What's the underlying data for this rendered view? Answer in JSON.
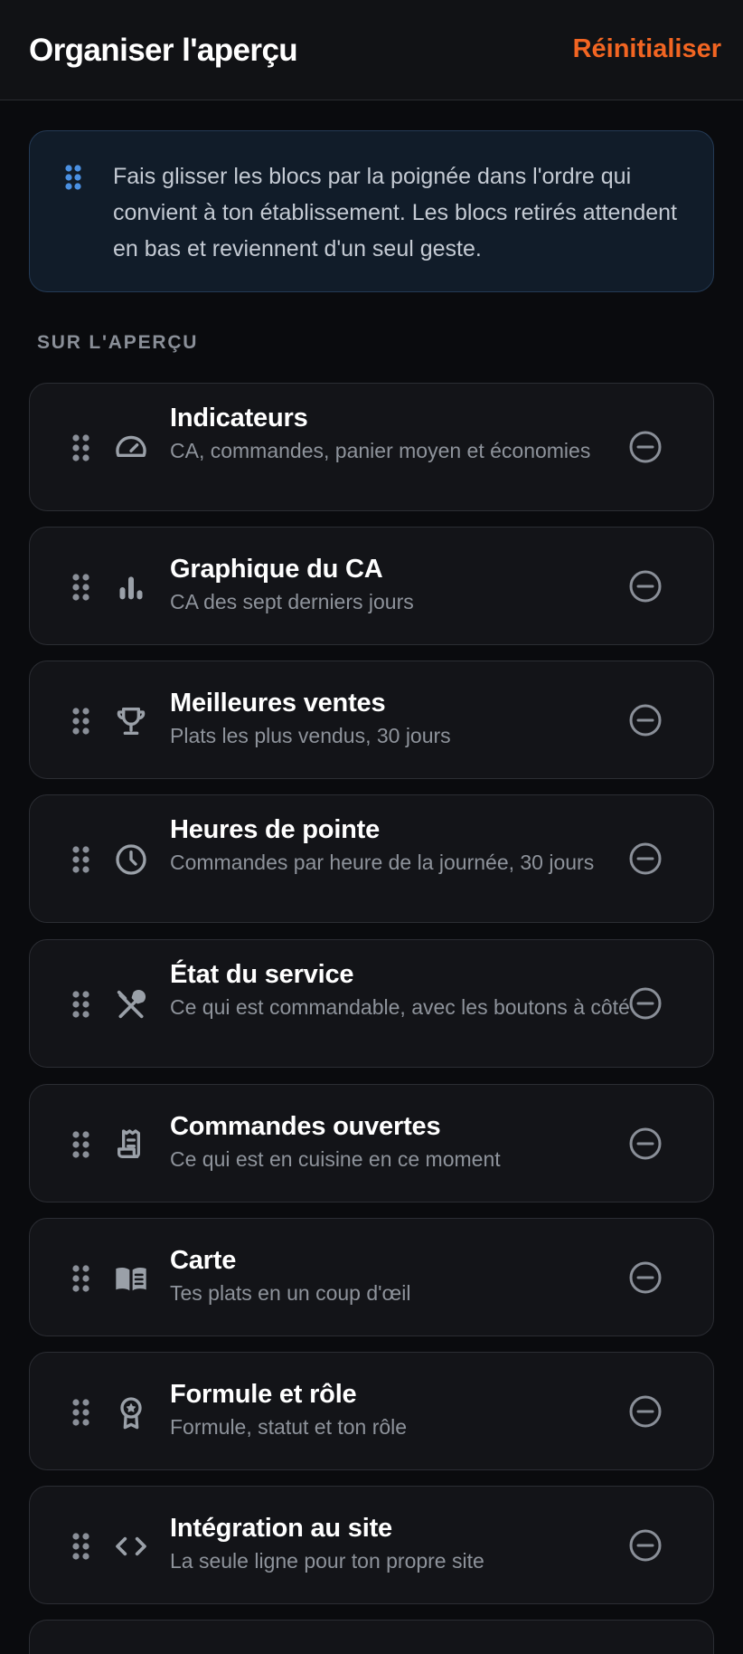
{
  "header": {
    "title": "Organiser l'aperçu",
    "reset_label": "Réinitialiser"
  },
  "info": {
    "text": "Fais glisser les blocs par la poignée dans l'ordre qui convient à ton établissement. Les blocs retirés attendent en bas et reviennent d'un seul geste."
  },
  "section": {
    "label": "SUR L'APERÇU"
  },
  "blocks": [
    {
      "title": "Indicateurs",
      "subtitle": "CA, commandes, panier moyen et économies",
      "icon": "gauge-icon"
    },
    {
      "title": "Graphique du CA",
      "subtitle": "CA des sept derniers jours",
      "icon": "bar-chart-icon"
    },
    {
      "title": "Meilleures ventes",
      "subtitle": "Plats les plus vendus, 30 jours",
      "icon": "trophy-icon"
    },
    {
      "title": "Heures de pointe",
      "subtitle": "Commandes par heure de la journée, 30 jours",
      "icon": "clock-icon"
    },
    {
      "title": "État du service",
      "subtitle": "Ce qui est commandable, avec les boutons à côté",
      "icon": "utensils-icon"
    },
    {
      "title": "Commandes ouvertes",
      "subtitle": "Ce qui est en cuisine en ce moment",
      "icon": "receipt-icon"
    },
    {
      "title": "Carte",
      "subtitle": "Tes plats en un coup d'œil",
      "icon": "menu-book-icon"
    },
    {
      "title": "Formule et rôle",
      "subtitle": "Formule, statut et ton rôle",
      "icon": "award-icon"
    },
    {
      "title": "Intégration au site",
      "subtitle": "La seule ligne pour ton propre site",
      "icon": "code-icon"
    }
  ],
  "colors": {
    "accent": "#f26522",
    "info_icon": "#4a90e2",
    "icon": "#9aa0a8"
  }
}
